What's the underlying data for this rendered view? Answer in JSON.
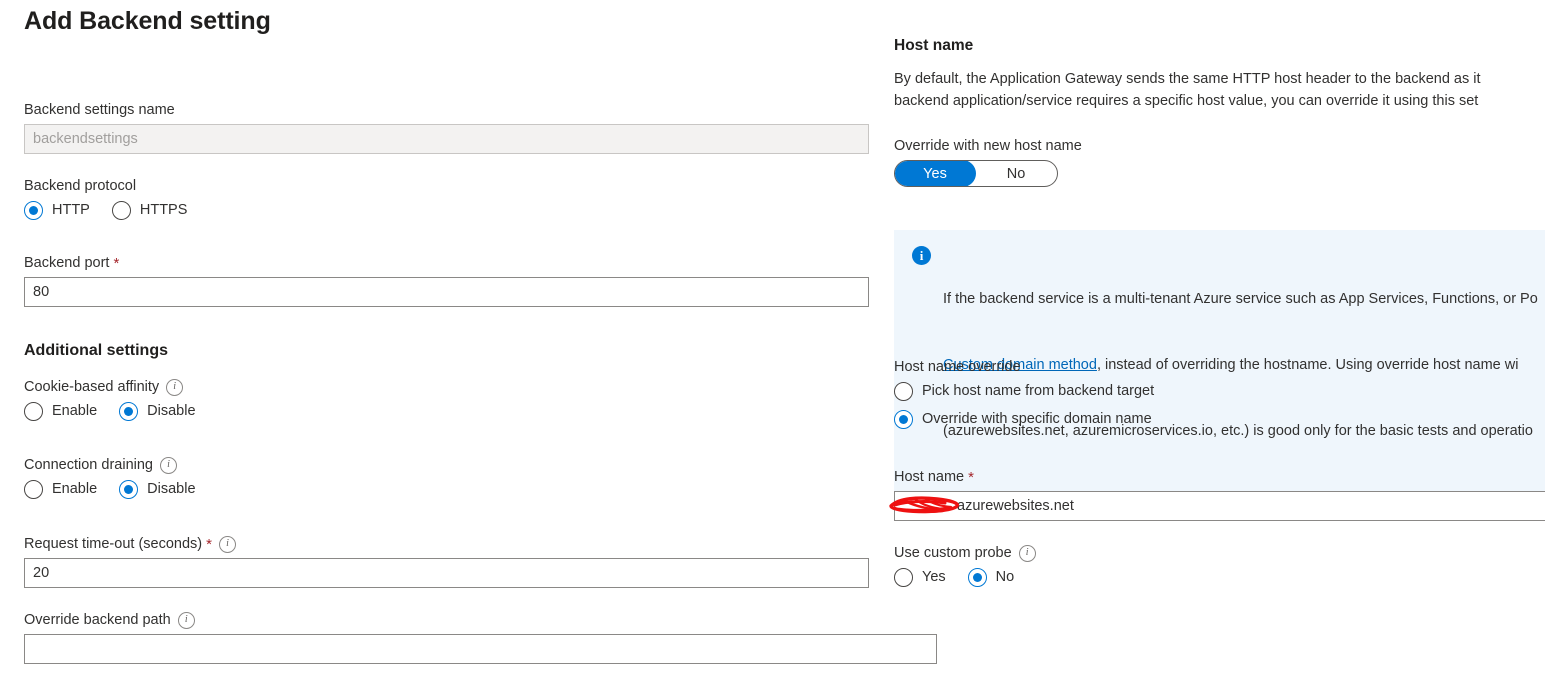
{
  "page": {
    "title": "Add Backend setting"
  },
  "colors": {
    "accent": "#0078d4",
    "required_asterisk": "#a4262c",
    "banner_bg": "#eff6fc",
    "link": "#0067b8",
    "redaction": "#ee1111"
  },
  "left": {
    "backend_settings_name": {
      "label": "Backend settings name",
      "value": "backendsettings",
      "placeholder": "backendsettings"
    },
    "backend_protocol": {
      "label": "Backend protocol",
      "options": [
        {
          "label": "HTTP",
          "selected": true
        },
        {
          "label": "HTTPS",
          "selected": false
        }
      ]
    },
    "backend_port": {
      "label": "Backend port",
      "required": "*",
      "value": "80"
    },
    "additional_settings_heading": "Additional settings",
    "cookie_based_affinity": {
      "label": "Cookie-based affinity",
      "info_icon": "info-icon",
      "options": [
        {
          "label": "Enable",
          "selected": false
        },
        {
          "label": "Disable",
          "selected": true
        }
      ]
    },
    "connection_draining": {
      "label": "Connection draining",
      "info_icon": "info-icon",
      "options": [
        {
          "label": "Enable",
          "selected": false
        },
        {
          "label": "Disable",
          "selected": true
        }
      ]
    },
    "request_timeout": {
      "label": "Request time-out (seconds)",
      "required": "*",
      "info_icon": "info-icon",
      "value": "20"
    },
    "override_backend_path": {
      "label": "Override backend path",
      "info_icon": "info-icon",
      "value": "",
      "placeholder": ""
    }
  },
  "right": {
    "host_name_section": {
      "title": "Host name",
      "description_line1": "By default, the Application Gateway sends the same HTTP host header to the backend as it",
      "description_line2": "backend application/service requires a specific host value, you can override it using this set"
    },
    "override_with_new_host_name": {
      "label": "Override with new host name",
      "options": [
        {
          "label": "Yes",
          "selected": true
        },
        {
          "label": "No",
          "selected": false
        }
      ]
    },
    "banner": {
      "icon": "info-icon",
      "line1_before": "If the backend service is a multi-tenant Azure service such as App Services, Functions, or Po",
      "line2_link": "Custom domain method",
      "line2_after": ", instead of overriding the hostname. Using override host name wi",
      "line3": "(azurewebsites.net, azuremicroservices.io, etc.) is good only for the basic tests and operatio"
    },
    "host_name_override": {
      "label": "Host name override",
      "options": [
        {
          "label": "Pick host name from backend target",
          "selected": false
        },
        {
          "label": "Override with specific domain name",
          "selected": true
        }
      ]
    },
    "host_name_field": {
      "label": "Host name",
      "required": "*",
      "value": "azurewebsites.net",
      "redaction": "red-scribble-redaction"
    },
    "use_custom_probe": {
      "label": "Use custom probe",
      "info_icon": "info-icon",
      "options": [
        {
          "label": "Yes",
          "selected": false
        },
        {
          "label": "No",
          "selected": true
        }
      ]
    }
  }
}
